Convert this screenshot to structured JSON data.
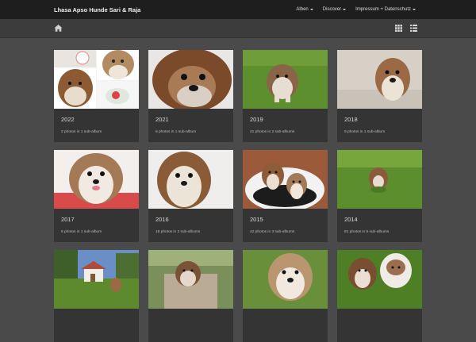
{
  "header": {
    "brand": "Lhasa Apso Hunde Sari & Raja",
    "nav": [
      {
        "label": "Alben"
      },
      {
        "label": "Discover"
      },
      {
        "label": "Impressum + Datenschutz"
      }
    ]
  },
  "toolbar": {
    "home_icon": "home-icon",
    "grid_icon": "grid-view-icon",
    "list_icon": "list-view-icon"
  },
  "albums": [
    {
      "title": "2022",
      "meta": "2 photos in 1 sub-album"
    },
    {
      "title": "2021",
      "meta": "6 photos in 1 sub-album"
    },
    {
      "title": "2019",
      "meta": "21 photos in 2 sub-albums"
    },
    {
      "title": "2018",
      "meta": "8 photos in 1 sub-album"
    },
    {
      "title": "2017",
      "meta": "6 photos in 1 sub-album"
    },
    {
      "title": "2016",
      "meta": "18 photos in 2 sub-albums"
    },
    {
      "title": "2015",
      "meta": "42 photos in 3 sub-albums"
    },
    {
      "title": "2014",
      "meta": "81 photos in 5 sub-albums"
    },
    {
      "title": "",
      "meta": ""
    },
    {
      "title": "",
      "meta": ""
    },
    {
      "title": "",
      "meta": ""
    },
    {
      "title": "",
      "meta": ""
    }
  ]
}
